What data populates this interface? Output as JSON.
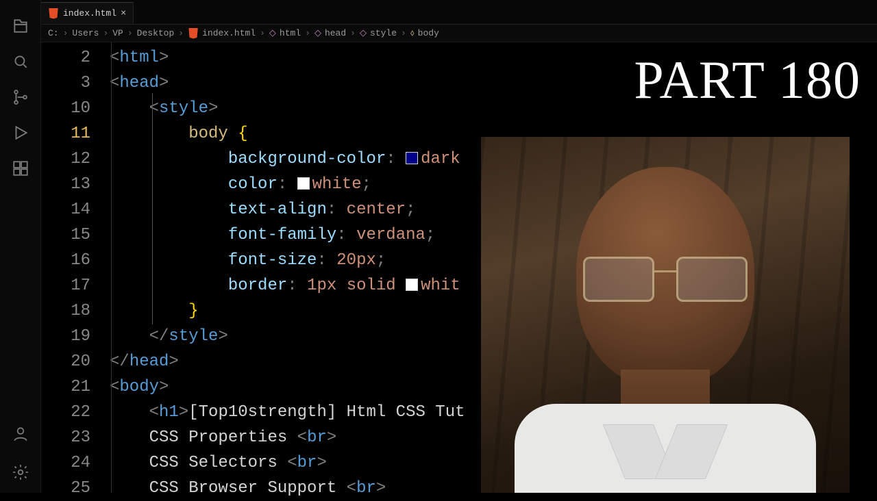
{
  "overlay": {
    "title": "PART 180"
  },
  "tab": {
    "label": "index.html"
  },
  "breadcrumbs": [
    {
      "text": "C:",
      "icon": ""
    },
    {
      "text": "Users",
      "icon": ""
    },
    {
      "text": "VP",
      "icon": ""
    },
    {
      "text": "Desktop",
      "icon": ""
    },
    {
      "text": "index.html",
      "icon": "html"
    },
    {
      "text": "html",
      "icon": "brace"
    },
    {
      "text": "head",
      "icon": "brace"
    },
    {
      "text": "style",
      "icon": "brace"
    },
    {
      "text": "body",
      "icon": "sel"
    }
  ],
  "gutter": [
    "2",
    "3",
    "10",
    "11",
    "12",
    "13",
    "14",
    "15",
    "16",
    "17",
    "18",
    "19",
    "20",
    "21",
    "22",
    "23",
    "24",
    "25"
  ],
  "activeLineIndex": 3,
  "code": {
    "l2": {
      "open": "<",
      "tag": "html",
      "close": ">"
    },
    "l3": {
      "open": "<",
      "tag": "head",
      "close": ">"
    },
    "l10": {
      "open": "<",
      "tag": "style",
      "close": ">"
    },
    "l11": {
      "sel": "body",
      "brace": "{"
    },
    "l12": {
      "prop": "background-color",
      "val": "dark",
      "colon": ":"
    },
    "l13": {
      "prop": "color",
      "val": "white",
      "colon": ":",
      "semi": ";"
    },
    "l14": {
      "prop": "text-align",
      "val": "center",
      "colon": ":",
      "semi": ";"
    },
    "l15": {
      "prop": "font-family",
      "val": "verdana",
      "colon": ":",
      "semi": ";"
    },
    "l16": {
      "prop": "font-size",
      "val": "20px",
      "colon": ":",
      "semi": ";"
    },
    "l17": {
      "prop": "border",
      "val1": "1px",
      "val2": "solid",
      "val3": "whit",
      "colon": ":"
    },
    "l18": {
      "brace": "}"
    },
    "l19": {
      "open": "</",
      "tag": "style",
      "close": ">"
    },
    "l20": {
      "open": "</",
      "tag": "head",
      "close": ">"
    },
    "l21": {
      "open": "<",
      "tag": "body",
      "close": ">"
    },
    "l22": {
      "t1": "<",
      "tag": "h1",
      "t2": ">",
      "text": "[Top10strength] Html CSS Tut"
    },
    "l23": {
      "text": "CSS Properties ",
      "t1": "<",
      "tag": "br",
      "t2": ">"
    },
    "l24": {
      "text": "CSS Selectors ",
      "t1": "<",
      "tag": "br",
      "t2": ">"
    },
    "l25": {
      "text": "CSS Browser Support ",
      "t1": "<",
      "tag": "br",
      "t2": ">"
    }
  }
}
